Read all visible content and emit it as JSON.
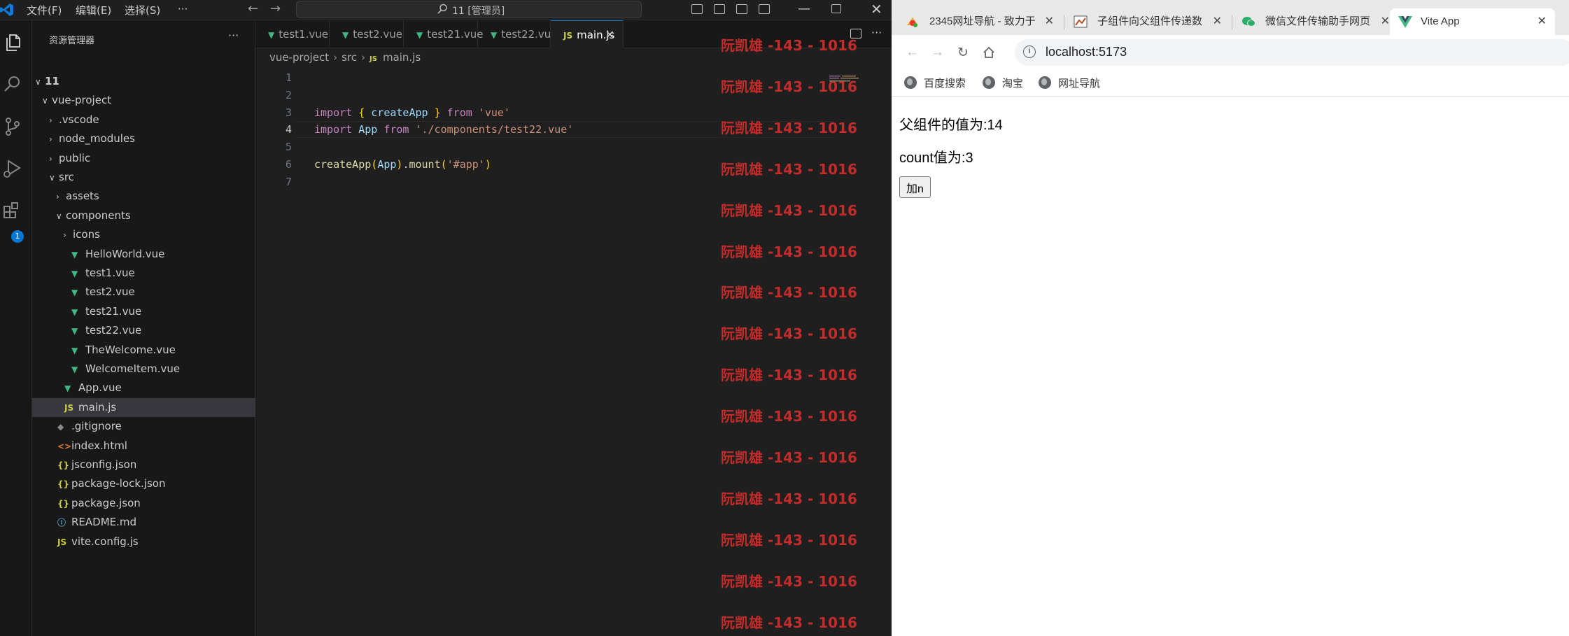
{
  "vscode": {
    "menu": [
      "文件(F)",
      "编辑(E)",
      "选择(S)",
      "···"
    ],
    "command_center": "11 [管理员]",
    "sidebar_title": "资源管理器",
    "sidebar_more": "···",
    "tree": [
      {
        "label": "11",
        "chev": "∨",
        "indent": 0,
        "icon": "",
        "bold": true
      },
      {
        "label": "vue-project",
        "chev": "∨",
        "indent": 1,
        "icon": ""
      },
      {
        "label": ".vscode",
        "chev": "›",
        "indent": 2,
        "icon": ""
      },
      {
        "label": "node_modules",
        "chev": "›",
        "indent": 2,
        "icon": ""
      },
      {
        "label": "public",
        "chev": "›",
        "indent": 2,
        "icon": ""
      },
      {
        "label": "src",
        "chev": "∨",
        "indent": 2,
        "icon": ""
      },
      {
        "label": "assets",
        "chev": "›",
        "indent": 3,
        "icon": ""
      },
      {
        "label": "components",
        "chev": "∨",
        "indent": 3,
        "icon": ""
      },
      {
        "label": "icons",
        "chev": "›",
        "indent": 4,
        "icon": ""
      },
      {
        "label": "HelloWorld.vue",
        "chev": "",
        "indent": 4,
        "icon": "vue"
      },
      {
        "label": "test1.vue",
        "chev": "",
        "indent": 4,
        "icon": "vue"
      },
      {
        "label": "test2.vue",
        "chev": "",
        "indent": 4,
        "icon": "vue"
      },
      {
        "label": "test21.vue",
        "chev": "",
        "indent": 4,
        "icon": "vue"
      },
      {
        "label": "test22.vue",
        "chev": "",
        "indent": 4,
        "icon": "vue"
      },
      {
        "label": "TheWelcome.vue",
        "chev": "",
        "indent": 4,
        "icon": "vue"
      },
      {
        "label": "WelcomeItem.vue",
        "chev": "",
        "indent": 4,
        "icon": "vue"
      },
      {
        "label": "App.vue",
        "chev": "",
        "indent": 3,
        "icon": "vue"
      },
      {
        "label": "main.js",
        "chev": "",
        "indent": 3,
        "icon": "js",
        "selected": true
      },
      {
        "label": ".gitignore",
        "chev": "",
        "indent": 2,
        "icon": "git"
      },
      {
        "label": "index.html",
        "chev": "",
        "indent": 2,
        "icon": "html"
      },
      {
        "label": "jsconfig.json",
        "chev": "",
        "indent": 2,
        "icon": "json"
      },
      {
        "label": "package-lock.json",
        "chev": "",
        "indent": 2,
        "icon": "json"
      },
      {
        "label": "package.json",
        "chev": "",
        "indent": 2,
        "icon": "json"
      },
      {
        "label": "README.md",
        "chev": "",
        "indent": 2,
        "icon": "info"
      },
      {
        "label": "vite.config.js",
        "chev": "",
        "indent": 2,
        "icon": "js"
      }
    ],
    "tabs": [
      {
        "label": "test1.vue",
        "icon": "vue"
      },
      {
        "label": "test2.vue",
        "icon": "vue"
      },
      {
        "label": "test21.vue",
        "icon": "vue"
      },
      {
        "label": "test22.vue",
        "icon": "vue"
      },
      {
        "label": "main.js",
        "icon": "js",
        "active": true
      }
    ],
    "breadcrumb": [
      "vue-project",
      "src",
      "main.js"
    ],
    "breadcrumb_js_badge": "JS",
    "current_line": 4,
    "code": [
      {
        "n": "1",
        "tokens": []
      },
      {
        "n": "2",
        "tokens": []
      },
      {
        "n": "3",
        "tokens": [
          [
            "kw",
            "import"
          ],
          [
            "plain",
            " "
          ],
          [
            "br",
            "{"
          ],
          [
            "plain",
            " "
          ],
          [
            "id",
            "createApp"
          ],
          [
            "plain",
            " "
          ],
          [
            "br",
            "}"
          ],
          [
            "plain",
            " "
          ],
          [
            "kw",
            "from"
          ],
          [
            "plain",
            " "
          ],
          [
            "str",
            "'vue'"
          ]
        ]
      },
      {
        "n": "4",
        "tokens": [
          [
            "kw",
            "import"
          ],
          [
            "plain",
            " "
          ],
          [
            "id",
            "App"
          ],
          [
            "plain",
            " "
          ],
          [
            "kw",
            "from"
          ],
          [
            "plain",
            " "
          ],
          [
            "str",
            "'./components/test22.vue'"
          ]
        ]
      },
      {
        "n": "5",
        "tokens": []
      },
      {
        "n": "6",
        "tokens": [
          [
            "fn",
            "createApp"
          ],
          [
            "br",
            "("
          ],
          [
            "id",
            "App"
          ],
          [
            "br",
            ")"
          ],
          [
            "plain",
            "."
          ],
          [
            "fn",
            "mount"
          ],
          [
            "br",
            "("
          ],
          [
            "str",
            "'#app'"
          ],
          [
            "br",
            ")"
          ]
        ]
      },
      {
        "n": "7",
        "tokens": []
      }
    ],
    "watermark": "阮凯雄 -143 - 1016",
    "watermark_count": 15,
    "activity_badge": "1",
    "colors": {
      "accent": "#0078d4",
      "watermark": "#c42b2b",
      "vue": "#41b883"
    }
  },
  "browser": {
    "tabs": [
      {
        "label": "2345网址导航 - 致力于",
        "fav": "fav-2345"
      },
      {
        "label": "子组件向父组件传递数",
        "fav": "fav-chart"
      },
      {
        "label": "微信文件传输助手网页",
        "fav": "fav-wechat"
      },
      {
        "label": "Vite App",
        "fav": "fav-vite",
        "active": true
      }
    ],
    "url": "localhost:5173",
    "bookmarks": [
      "百度搜索",
      "淘宝",
      "网址导航"
    ],
    "page": {
      "parent_value_text": "父组件的值为:14",
      "count_text": "count值为:3",
      "add_button": "加n"
    }
  }
}
